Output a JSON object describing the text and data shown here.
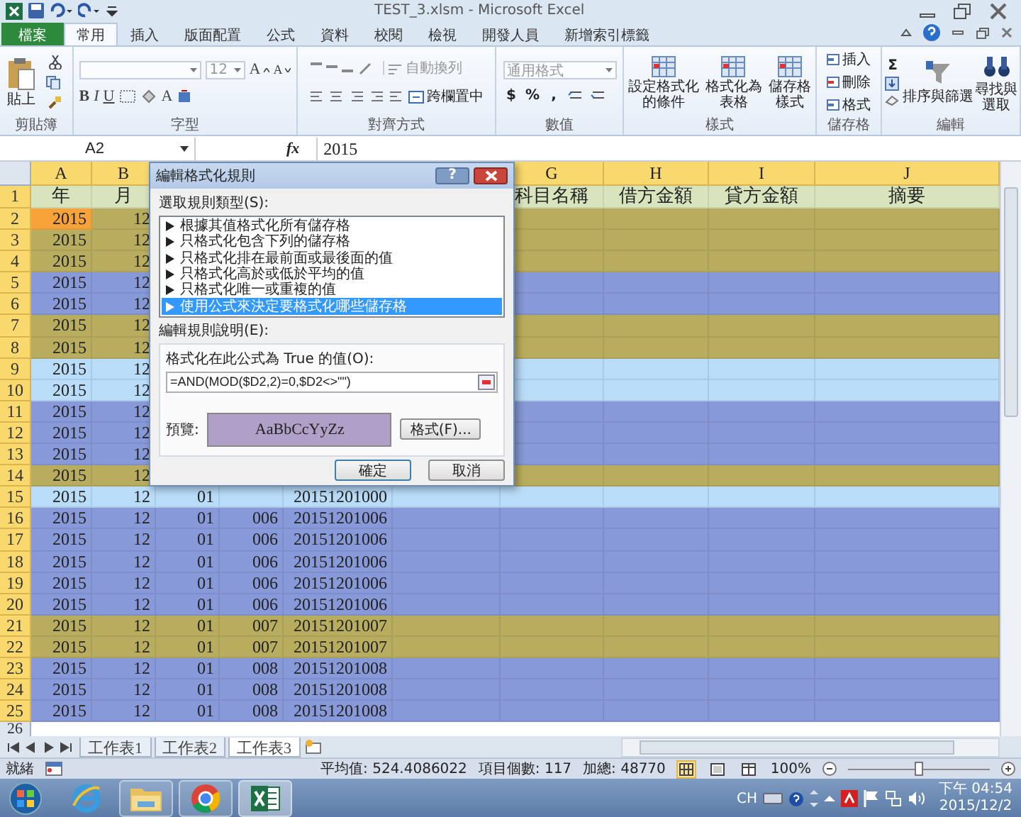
{
  "window": {
    "title": "TEST_3.xlsm - Microsoft Excel"
  },
  "ribbon_tabs": [
    {
      "label": "檔案",
      "kind": "file",
      "selected": false
    },
    {
      "label": "常用",
      "kind": "tab",
      "selected": true
    },
    {
      "label": "插入",
      "kind": "tab",
      "selected": false
    },
    {
      "label": "版面配置",
      "kind": "tab",
      "selected": false
    },
    {
      "label": "公式",
      "kind": "tab",
      "selected": false
    },
    {
      "label": "資料",
      "kind": "tab",
      "selected": false
    },
    {
      "label": "校閱",
      "kind": "tab",
      "selected": false
    },
    {
      "label": "檢視",
      "kind": "tab",
      "selected": false
    },
    {
      "label": "開發人員",
      "kind": "tab",
      "selected": false
    },
    {
      "label": "新增索引標籤",
      "kind": "tab",
      "selected": false
    }
  ],
  "ribbon_groups": [
    {
      "kind": "clipboard",
      "label": "剪貼簿",
      "paste": "貼上"
    },
    {
      "kind": "font",
      "label": "字型",
      "size": "12",
      "grow": "A",
      "shrink": "A",
      "styles": [
        "B",
        "I",
        "U"
      ],
      "color_letter": "A"
    },
    {
      "kind": "alignment",
      "label": "對齊方式",
      "wrap": "自動換列",
      "merge": "跨欄置中"
    },
    {
      "kind": "number",
      "label": "數值",
      "format": "通用格式",
      "symbols": [
        "$",
        "%",
        ","
      ]
    },
    {
      "kind": "styles",
      "label": "樣式",
      "buttons": [
        {
          "lines": [
            "設定格式化",
            "的條件"
          ]
        },
        {
          "lines": [
            "格式化為",
            "表格"
          ]
        },
        {
          "lines": [
            "儲存格",
            "樣式"
          ]
        }
      ]
    },
    {
      "kind": "cells",
      "label": "儲存格",
      "buttons": [
        "插入",
        "刪除",
        "格式"
      ]
    },
    {
      "kind": "editing",
      "label": "編輯",
      "sum": "Σ",
      "buttons": [
        {
          "lines": [
            "排序與篩選"
          ]
        },
        {
          "lines": [
            "尋找與",
            "選取"
          ]
        }
      ]
    }
  ],
  "formula_bar": {
    "name_box": "A2",
    "function_label": "fx",
    "value": "2015"
  },
  "column_headers": {
    "A": "A",
    "B": "B",
    "G": "G",
    "H": "H",
    "I": "I",
    "J": "J"
  },
  "rows": [
    {
      "number": "1",
      "kind": "header",
      "color": "#d8e4bc",
      "active": false,
      "A": "年",
      "B": "月",
      "G": "科目名稱",
      "H": "借方金額",
      "I": "貸方金額",
      "J": "摘要"
    },
    {
      "number": "2",
      "kind": "data",
      "color": "#b8ad5e",
      "active": true,
      "A": "2015",
      "B": "12"
    },
    {
      "number": "3",
      "kind": "data",
      "color": "#b8ad5e",
      "active": false,
      "A": "2015",
      "B": "12"
    },
    {
      "number": "4",
      "kind": "data",
      "color": "#b8ad5e",
      "active": false,
      "A": "2015",
      "B": "12"
    },
    {
      "number": "5",
      "kind": "data",
      "color": "#8799d8",
      "active": false,
      "A": "2015",
      "B": "12"
    },
    {
      "number": "6",
      "kind": "data",
      "color": "#8799d8",
      "active": false,
      "A": "2015",
      "B": "12"
    },
    {
      "number": "7",
      "kind": "data",
      "color": "#b8ad5e",
      "active": false,
      "A": "2015",
      "B": "12"
    },
    {
      "number": "8",
      "kind": "data",
      "color": "#b8ad5e",
      "active": false,
      "A": "2015",
      "B": "12"
    },
    {
      "number": "9",
      "kind": "data",
      "color": "#b9dcf8",
      "active": false,
      "A": "2015",
      "B": "12"
    },
    {
      "number": "10",
      "kind": "data",
      "color": "#b9dcf8",
      "active": false,
      "A": "2015",
      "B": "12"
    },
    {
      "number": "11",
      "kind": "data",
      "color": "#8799d8",
      "active": false,
      "A": "2015",
      "B": "12"
    },
    {
      "number": "12",
      "kind": "data",
      "color": "#8799d8",
      "active": false,
      "A": "2015",
      "B": "12"
    },
    {
      "number": "13",
      "kind": "data",
      "color": "#8799d8",
      "active": false,
      "A": "2015",
      "B": "12"
    },
    {
      "number": "14",
      "kind": "data",
      "color": "#b8ad5e",
      "active": false,
      "A": "2015",
      "B": "12"
    },
    {
      "number": "15",
      "kind": "data",
      "color": "#b9dcf8",
      "active": false,
      "A": "2015",
      "B": "12",
      "C": "01",
      "E": "20151201000"
    },
    {
      "number": "16",
      "kind": "data",
      "color": "#8799d8",
      "active": false,
      "A": "2015",
      "B": "12",
      "C": "01",
      "D": "006",
      "E": "20151201006"
    },
    {
      "number": "17",
      "kind": "data",
      "color": "#8799d8",
      "active": false,
      "A": "2015",
      "B": "12",
      "C": "01",
      "D": "006",
      "E": "20151201006"
    },
    {
      "number": "18",
      "kind": "data",
      "color": "#8799d8",
      "active": false,
      "A": "2015",
      "B": "12",
      "C": "01",
      "D": "006",
      "E": "20151201006"
    },
    {
      "number": "19",
      "kind": "data",
      "color": "#8799d8",
      "active": false,
      "A": "2015",
      "B": "12",
      "C": "01",
      "D": "006",
      "E": "20151201006"
    },
    {
      "number": "20",
      "kind": "data",
      "color": "#8799d8",
      "active": false,
      "A": "2015",
      "B": "12",
      "C": "01",
      "D": "006",
      "E": "20151201006"
    },
    {
      "number": "21",
      "kind": "data",
      "color": "#b8ad5e",
      "active": false,
      "A": "2015",
      "B": "12",
      "C": "01",
      "D": "007",
      "E": "20151201007"
    },
    {
      "number": "22",
      "kind": "data",
      "color": "#b8ad5e",
      "active": false,
      "A": "2015",
      "B": "12",
      "C": "01",
      "D": "007",
      "E": "20151201007"
    },
    {
      "number": "23",
      "kind": "data",
      "color": "#8799d8",
      "active": false,
      "A": "2015",
      "B": "12",
      "C": "01",
      "D": "008",
      "E": "20151201008"
    },
    {
      "number": "24",
      "kind": "data",
      "color": "#8799d8",
      "active": false,
      "A": "2015",
      "B": "12",
      "C": "01",
      "D": "008",
      "E": "20151201008"
    },
    {
      "number": "25",
      "kind": "data",
      "color": "#8799d8",
      "active": false,
      "A": "2015",
      "B": "12",
      "C": "01",
      "D": "008",
      "E": "20151201008"
    },
    {
      "number": "26",
      "kind": "data"
    }
  ],
  "dialog": {
    "title": "編輯格式化規則",
    "help": "?",
    "rule_type_label": "選取規則類型(S):",
    "rule_types": [
      {
        "label": "根據其值格式化所有儲存格",
        "selected": false
      },
      {
        "label": "只格式化包含下列的儲存格",
        "selected": false
      },
      {
        "label": "只格式化排在最前面或最後面的值",
        "selected": false
      },
      {
        "label": "只格式化高於或低於平均的值",
        "selected": false
      },
      {
        "label": "只格式化唯一或重複的值",
        "selected": false
      },
      {
        "label": "使用公式來決定要格式化哪些儲存格",
        "selected": true
      }
    ],
    "description_label": "編輯規則說明(E):",
    "formula_label": "格式化在此公式為 True 的值(O):",
    "formula": "=AND(MOD($D2,2)=0,$D2<>\"\")",
    "preview_label": "預覽:",
    "preview_text": "AaBbCcYyZz",
    "format_button": "格式(F)...",
    "ok": "確定",
    "cancel": "取消"
  },
  "sheet_tabs": [
    {
      "label": "工作表1",
      "selected": false
    },
    {
      "label": "工作表2",
      "selected": false
    },
    {
      "label": "工作表3",
      "selected": true
    }
  ],
  "status_bar": {
    "ready": "就緒",
    "average": "平均值: 524.4086022",
    "count": "項目個數: 117",
    "sum": "加總: 48770",
    "views": [
      {
        "kind": "normal",
        "selected": true
      },
      {
        "kind": "layout",
        "selected": false
      },
      {
        "kind": "break",
        "selected": false
      }
    ],
    "zoom": "100%",
    "zoom_slider": {
      "level": 0.5
    }
  },
  "taskbar": {
    "apps": [
      {
        "kind": "ie",
        "selected": false
      },
      {
        "kind": "folder",
        "selected": false
      },
      {
        "kind": "chrome",
        "selected": false
      },
      {
        "kind": "excel",
        "selected": true
      }
    ],
    "ime": "CH",
    "time": "下午 04:54",
    "date": "2015/12/2"
  }
}
